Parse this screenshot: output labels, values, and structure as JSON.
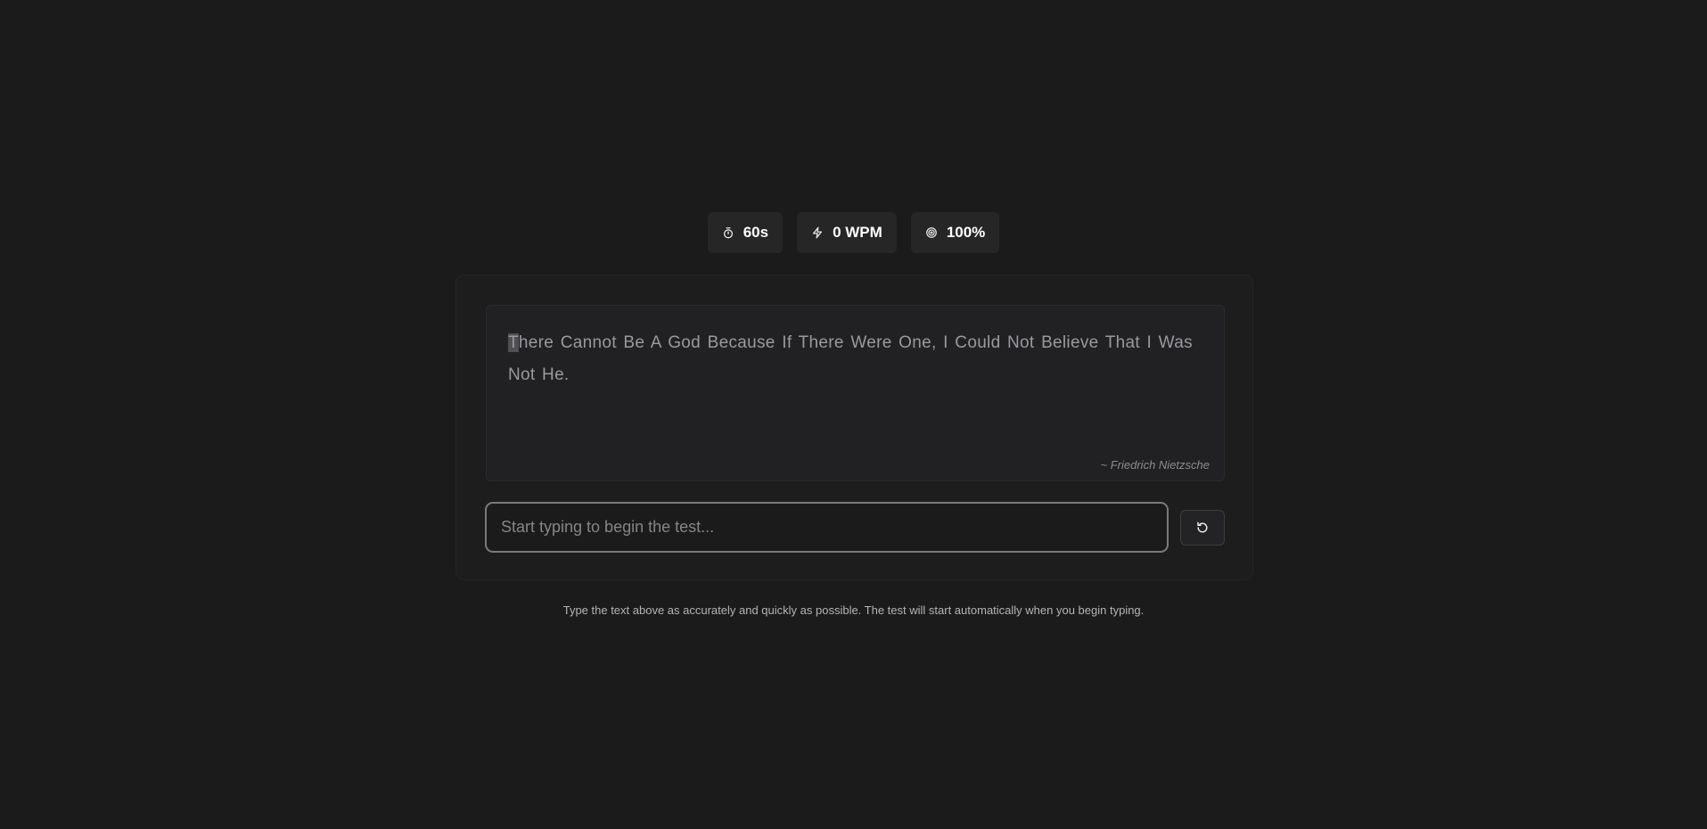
{
  "stats": {
    "timer": {
      "icon": "timer-icon",
      "value": "60s"
    },
    "wpm": {
      "icon": "lightning-icon",
      "value": "0 WPM"
    },
    "accuracy": {
      "icon": "target-icon",
      "value": "100%"
    }
  },
  "quote": {
    "first_char": "T",
    "rest": "here Cannot Be A God Because If There Were One, I Could Not Believe That I Was Not He.",
    "author": "~ Friedrich Nietzsche"
  },
  "input": {
    "value": "",
    "placeholder": "Start typing to begin the test..."
  },
  "reset": {
    "icon": "refresh-icon"
  },
  "instructions": "Type the text above as accurately and quickly as possible. The test will start automatically when you begin typing.",
  "colors": {
    "background": "#1b1b1b",
    "card": "#1d1d1e",
    "stat_pill": "#262626",
    "quote_text": "#9a9a9e",
    "input_border": "#7a7a7e"
  }
}
